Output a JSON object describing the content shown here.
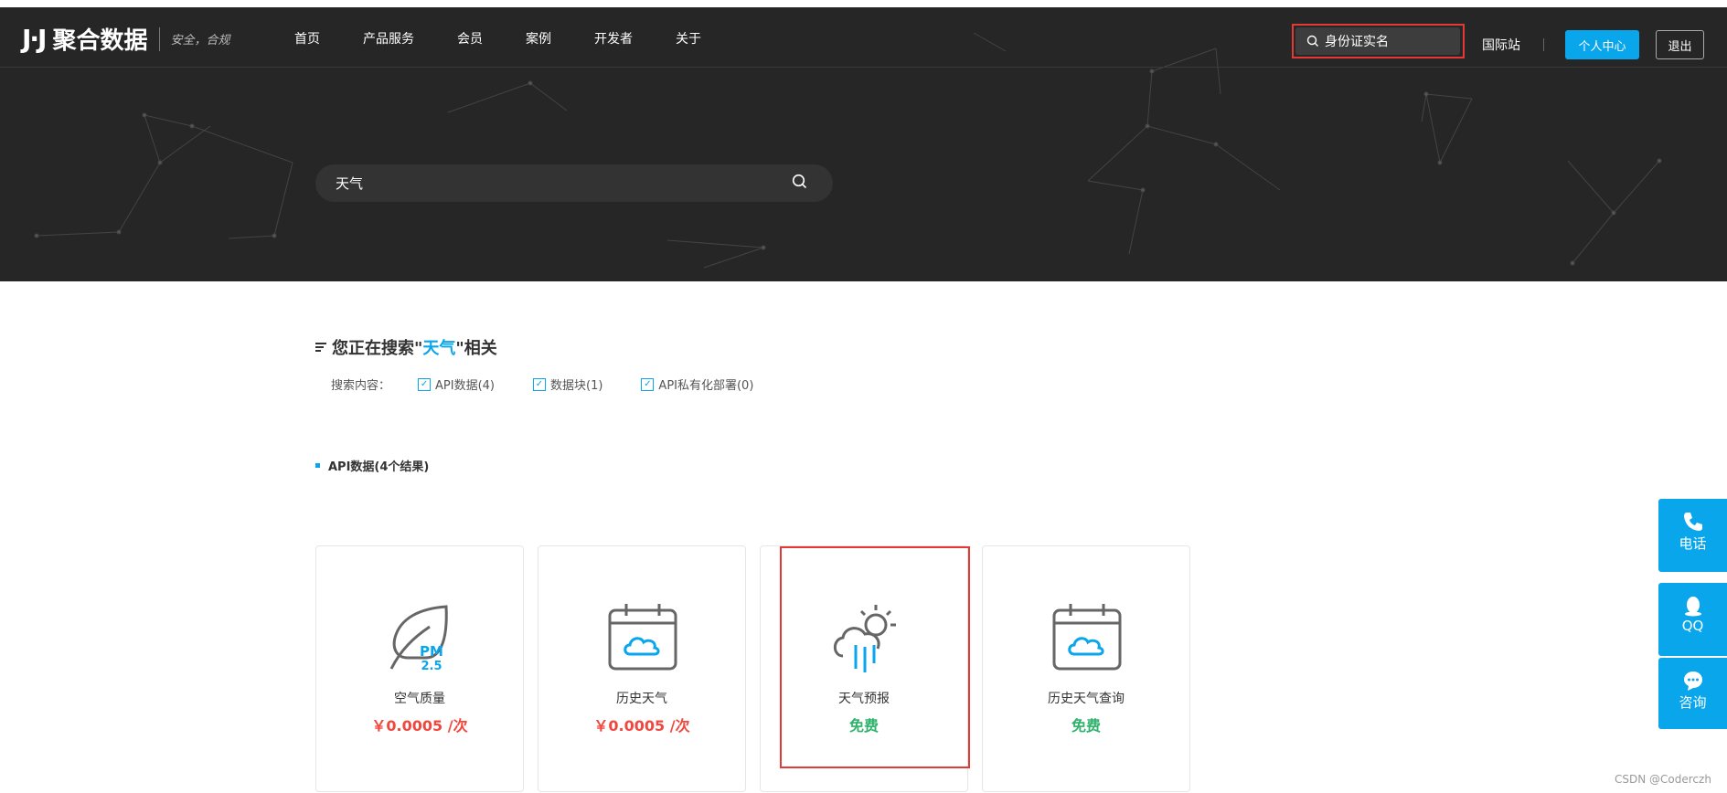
{
  "header": {
    "logo_mark": "J·J",
    "logo_text": "聚合数据",
    "slogan": "安全，合规",
    "nav": [
      "首页",
      "产品服务",
      "会员",
      "案例",
      "开发者",
      "关于"
    ],
    "top_search_value": "身份证实名",
    "intl_label": "国际站",
    "center_button": "个人中心",
    "logout_button": "退出"
  },
  "search": {
    "value": "天气"
  },
  "results": {
    "heading_prefix": "您正在搜索\"",
    "keyword": "天气",
    "heading_suffix": "\"相关",
    "filter_label": "搜索内容：",
    "filters": [
      "API数据(4)",
      "数据块(1)",
      "API私有化部署(0)"
    ],
    "section_title": "API数据(4个结果)"
  },
  "cards": [
    {
      "name": "空气质量",
      "price": "￥0.0005 /次",
      "icon": "pm25-leaf-icon",
      "pm_top": "PM",
      "pm_bottom": "2.5"
    },
    {
      "name": "历史天气",
      "price": "￥0.0005 /次",
      "icon": "calendar-cloud-icon"
    },
    {
      "name": "天气预报",
      "price": "免费",
      "icon": "weather-forecast-icon"
    },
    {
      "name": "历史天气查询",
      "price": "免费",
      "icon": "calendar-cloud-icon"
    }
  ],
  "side_tools": [
    "电话",
    "QQ",
    "咨询"
  ],
  "watermark": "CSDN @Coderczh",
  "colors": {
    "accent": "#0aa6ec",
    "paid": "#f0483e",
    "free": "#2fb36b",
    "hero_bg": "#262626",
    "highlight_box": "#e53935"
  }
}
